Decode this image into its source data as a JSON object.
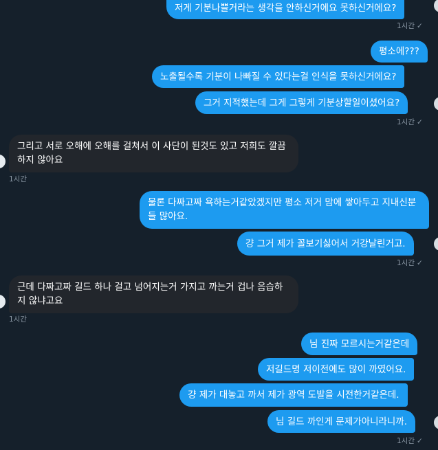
{
  "messages": [
    {
      "text": "저게 기분나쁠거라는 생각을 안하신거에요 못하신거에요?"
    },
    {
      "text": "평소에???"
    },
    {
      "text": "노출될수록 기분이 나빠질 수 있다는걸 인식을 못하신거에요?"
    },
    {
      "text": "그거 지적했는데 그게 그렇게 기분상할일이셨어요?"
    },
    {
      "text": "그리고 서로 오해에 오해를 걸쳐서 이 사단이 된것도 있고 저희도 깔끔하지 않아요"
    },
    {
      "text": "물론 다짜고짜 욕하는거같았겠지만 평소 저거 맘에 쌓아두고 지내신분들 많아요."
    },
    {
      "text": "걍 그거 제가 꼴보기싫어서 거강날린거고."
    },
    {
      "text": "근데 다짜고짜 길드 하나 걸고 넘어지는거 가지고 까는거 겁나 음습하지 않냐고요"
    },
    {
      "text": "님 진짜 모르시는거같은데"
    },
    {
      "text": "저길드명 저이전에도 많이 까였어요."
    },
    {
      "text": "걍 제가 대놓고 까서 제가 광역 도발을 시전한거같은데."
    },
    {
      "text": "님 길드 까인게 문제가아니라니까."
    }
  ],
  "timestamps": {
    "t1": "1시간",
    "t2": "1시간",
    "t3": "1시간",
    "t4": "1시간",
    "t5": "1시간",
    "t6": "1시간",
    "t7": "1시간"
  },
  "read_mark": "✓",
  "colors": {
    "background": "#15202b",
    "sent_bubble": "#1d9bf0",
    "received_bubble": "#22262c",
    "meta_text": "#8b98a5"
  }
}
